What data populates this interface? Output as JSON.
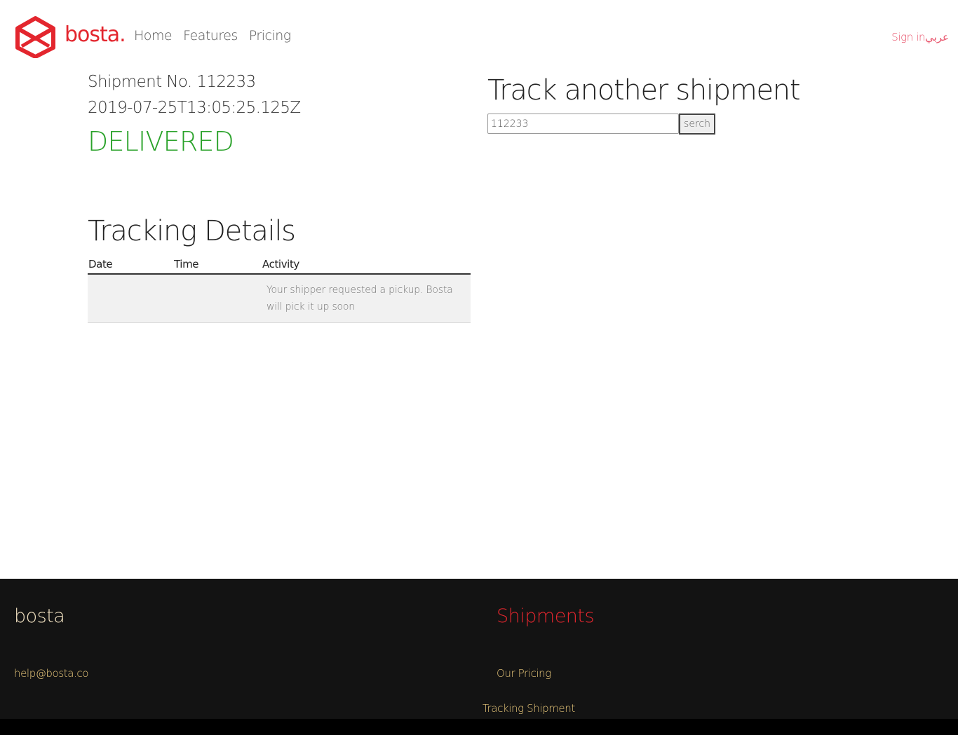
{
  "header": {
    "logo_text": "bosta.",
    "nav": [
      "Home",
      "Features",
      "Pricing"
    ],
    "sign_in": "Sign in",
    "language": "عربي"
  },
  "shipment": {
    "number": "Shipment No. 112233",
    "date": "2019-07-25T13:05:25.125Z",
    "status": "DELIVERED"
  },
  "track": {
    "title": "Track another shipment",
    "input_value": "112233",
    "button_label": "serch"
  },
  "details": {
    "title": "Tracking Details",
    "columns": [
      "Date",
      "Time",
      "Activity"
    ],
    "rows": [
      {
        "date": "",
        "time": "",
        "activity": "Your shipper requested a pickup. Bosta will pick it up soon"
      }
    ]
  },
  "footer": {
    "brand": "bosta",
    "email": "help@bosta.co",
    "heading": "Shipments",
    "links": [
      "Our Pricing",
      "Tracking Shipment"
    ]
  },
  "colors": {
    "brand_red": "#e3262e",
    "status_green": "#2aa22a",
    "footer_bg": "#131313",
    "footer_link": "#e8c77a"
  }
}
